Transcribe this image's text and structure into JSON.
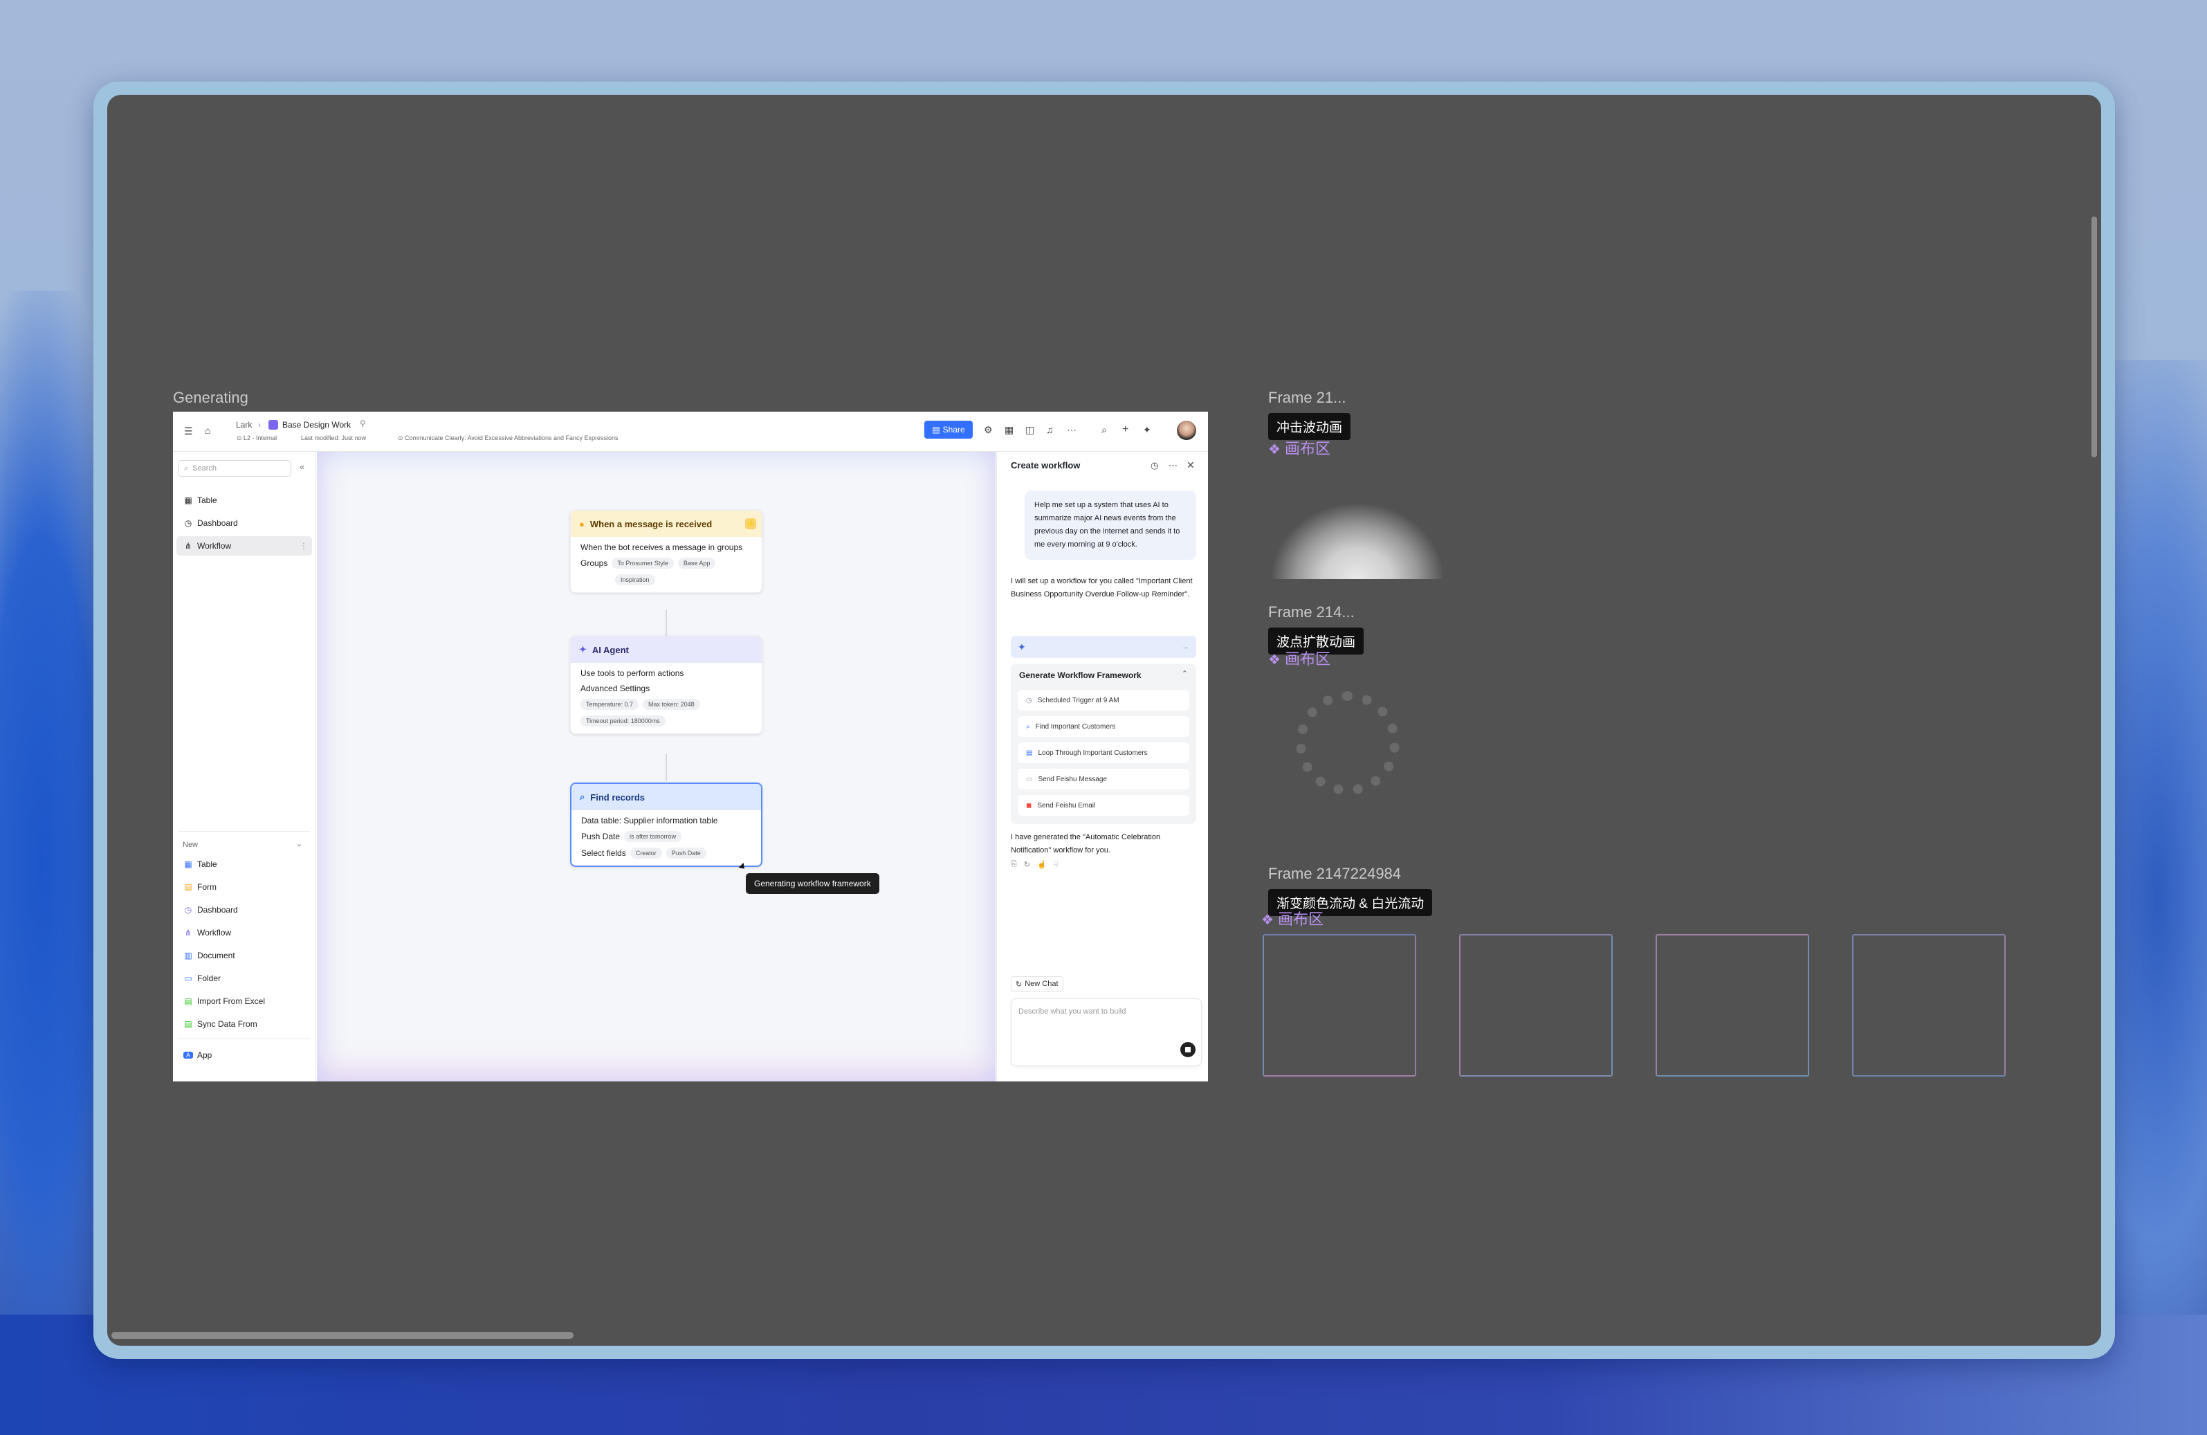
{
  "canvas": {
    "frame_title": "Generating",
    "frame_21": "Frame 21...",
    "frame_21_cn": "冲击波动画",
    "frame_214": "Frame 214...",
    "frame_214_cn": "波点扩散动画",
    "frame_full": "Frame 2147224984",
    "frame_full_cn": "渐变颜色流动 & 白光流动",
    "canvas_area": "画布区"
  },
  "app": {
    "breadcrumb_root": "Lark",
    "doc_title": "Base Design Work",
    "meta_level": "L2 - Internal",
    "meta_modified": "Last modified: Just now",
    "meta_note": "Communicate Clearly: Avoid Excessive Abbreviations and Fancy Expressions",
    "share_label": "Share"
  },
  "sidebar": {
    "search_placeholder": "Search",
    "items": [
      {
        "label": "Table",
        "icon": "table-icon"
      },
      {
        "label": "Dashboard",
        "icon": "dashboard-icon"
      },
      {
        "label": "Workflow",
        "icon": "workflow-icon"
      }
    ],
    "new_label": "New",
    "new_items": [
      {
        "label": "Table",
        "color": "#3370ff"
      },
      {
        "label": "Form",
        "color": "#f5a623"
      },
      {
        "label": "Dashboard",
        "color": "#7b67ee"
      },
      {
        "label": "Workflow",
        "color": "#7b67ee"
      },
      {
        "label": "Document",
        "color": "#3370ff"
      },
      {
        "label": "Folder",
        "color": "#3370ff"
      },
      {
        "label": "Import From Excel",
        "color": "#34c724"
      },
      {
        "label": "Sync Data From",
        "color": "#34c724"
      }
    ],
    "app_label": "App"
  },
  "workflow": {
    "node1": {
      "title": "When a message is received",
      "line1": "When the bot receives a message in groups",
      "groups_label": "Groups",
      "groups": [
        "To Prosumer Style",
        "Base App",
        "Inspiration"
      ]
    },
    "node2": {
      "title": "AI Agent",
      "line1": "Use tools to perform actions",
      "line2": "Advanced Settings",
      "settings": [
        "Temperature: 0.7",
        "Max token: 2048",
        "Timeout period: 180000ms"
      ]
    },
    "node3": {
      "title": "Find records",
      "line1": "Data table: Supplier information table",
      "push_label": "Push Date",
      "push_value": "is after tomorrow",
      "select_label": "Select fields",
      "fields": [
        "Creator",
        "Push Date"
      ]
    },
    "tooltip": "Generating workflow framework"
  },
  "panel": {
    "title": "Create workflow",
    "user_message": "Help me set up a system that uses AI to summarize major AI news events from the previous day on the internet and sends it to me every morning at 9 o'clock.",
    "reply1": "I will set up a workflow for you called \"Important Client Business Opportunity Overdue Follow-up Reminder\".",
    "framework_title": "Generate Workflow Framework",
    "steps": [
      {
        "label": "Scheduled Trigger at 9 AM",
        "color": "#8f959e"
      },
      {
        "label": "Find Important Customers",
        "color": "#3370ff"
      },
      {
        "label": "Loop Through Important Customers",
        "color": "#3370ff"
      },
      {
        "label": "Send Feishu Message",
        "color": "#8f959e"
      },
      {
        "label": "Send Feishu Email",
        "color": "#f54a45"
      }
    ],
    "reply2": "I have generated the \"Automatic Celebration Notification\" workflow for you.",
    "new_chat": "New Chat",
    "input_placeholder": "Describe what you want to build"
  }
}
